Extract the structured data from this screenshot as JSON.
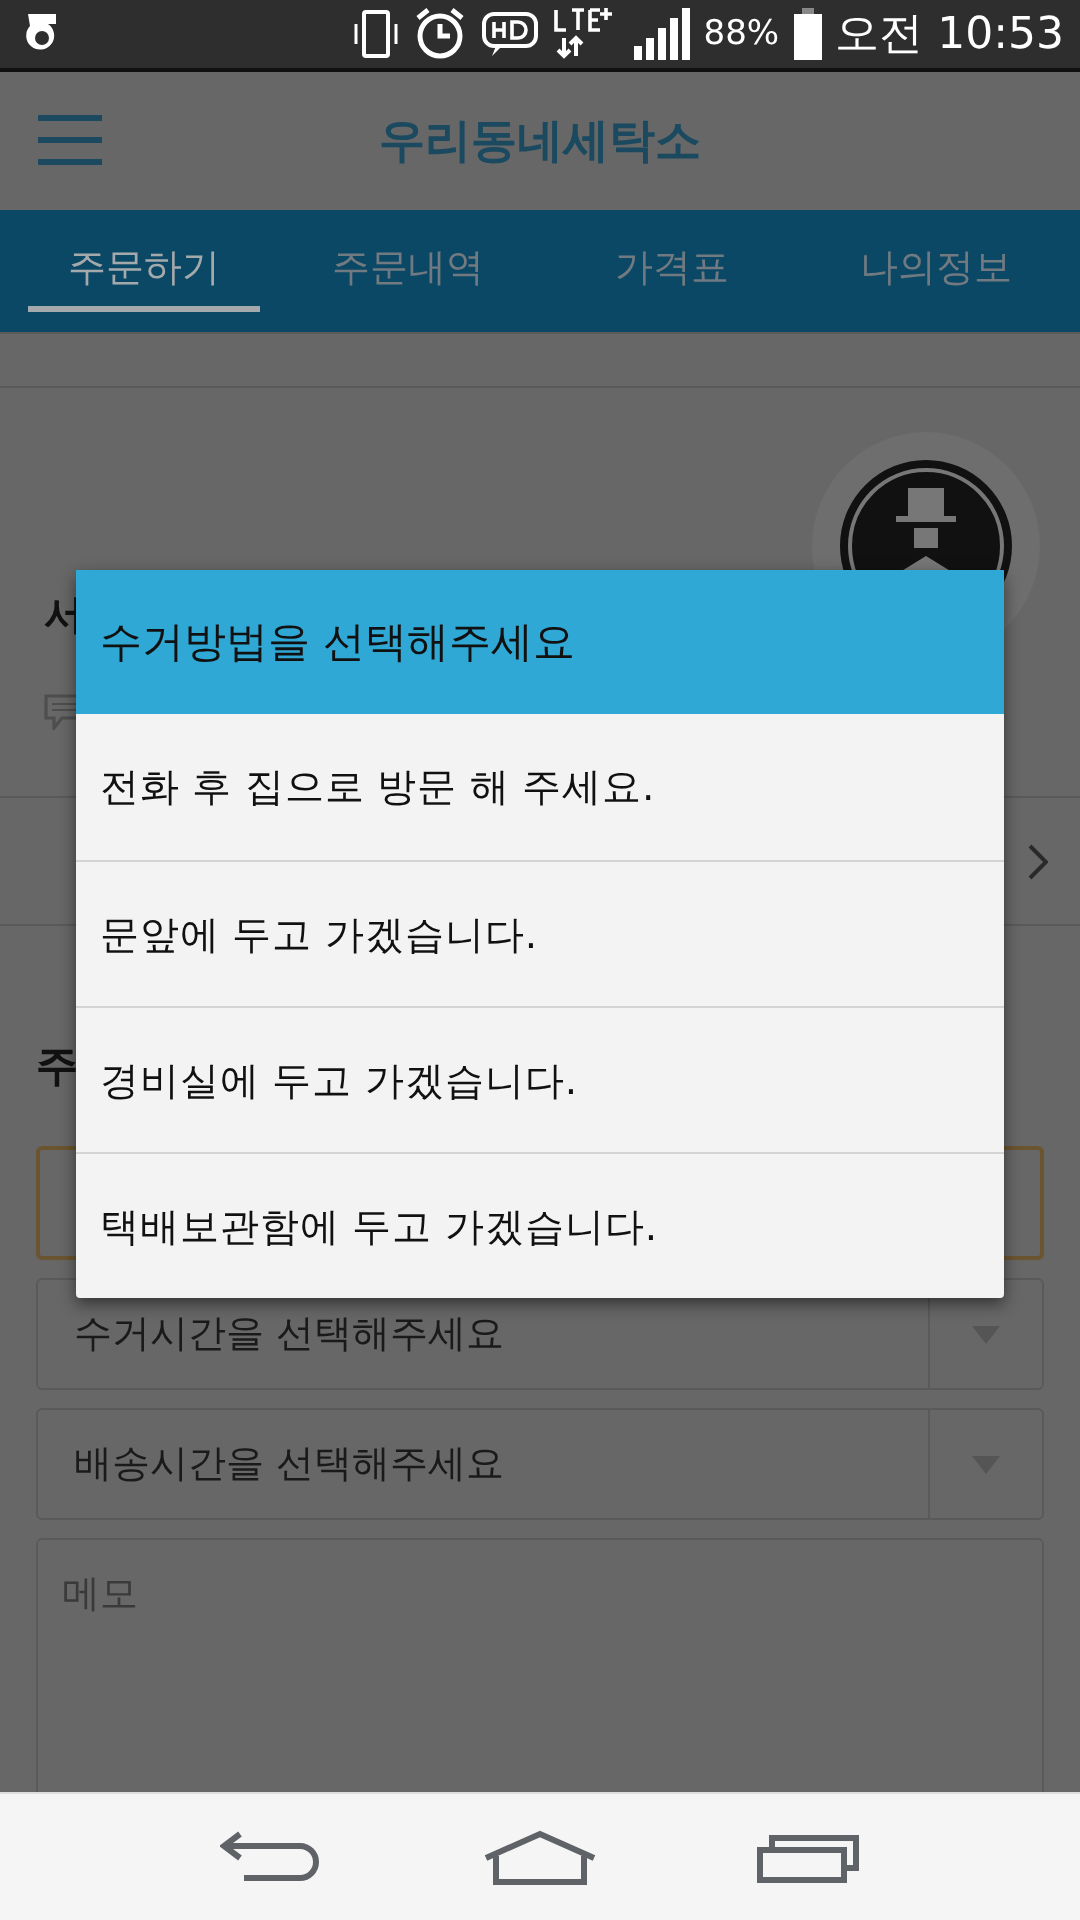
{
  "status_bar": {
    "battery": "88%",
    "time": "오전 10:53"
  },
  "app_bar": {
    "title": "우리동네세탁소"
  },
  "tabs": [
    {
      "label": "주문하기",
      "selected": true
    },
    {
      "label": "주문내역",
      "selected": false
    },
    {
      "label": "가격표",
      "selected": false
    },
    {
      "label": "나의정보",
      "selected": false
    }
  ],
  "profile": {
    "name_fragment": "서"
  },
  "section": {
    "title_fragment": "주"
  },
  "form": {
    "selects": [
      {
        "label": "수거시간을 선택해주세요"
      },
      {
        "label": "배송시간을 선택해주세요"
      }
    ],
    "memo": {
      "placeholder": "메모"
    }
  },
  "dialog": {
    "title": "수거방법을 선택해주세요",
    "options": [
      {
        "label": "전화 후 집으로 방문 해 주세요."
      },
      {
        "label": "문앞에 두고 가겠습니다."
      },
      {
        "label": "경비실에 두고 가겠습니다."
      },
      {
        "label": "택배보관함에 두고 가겠습니다."
      }
    ]
  }
}
